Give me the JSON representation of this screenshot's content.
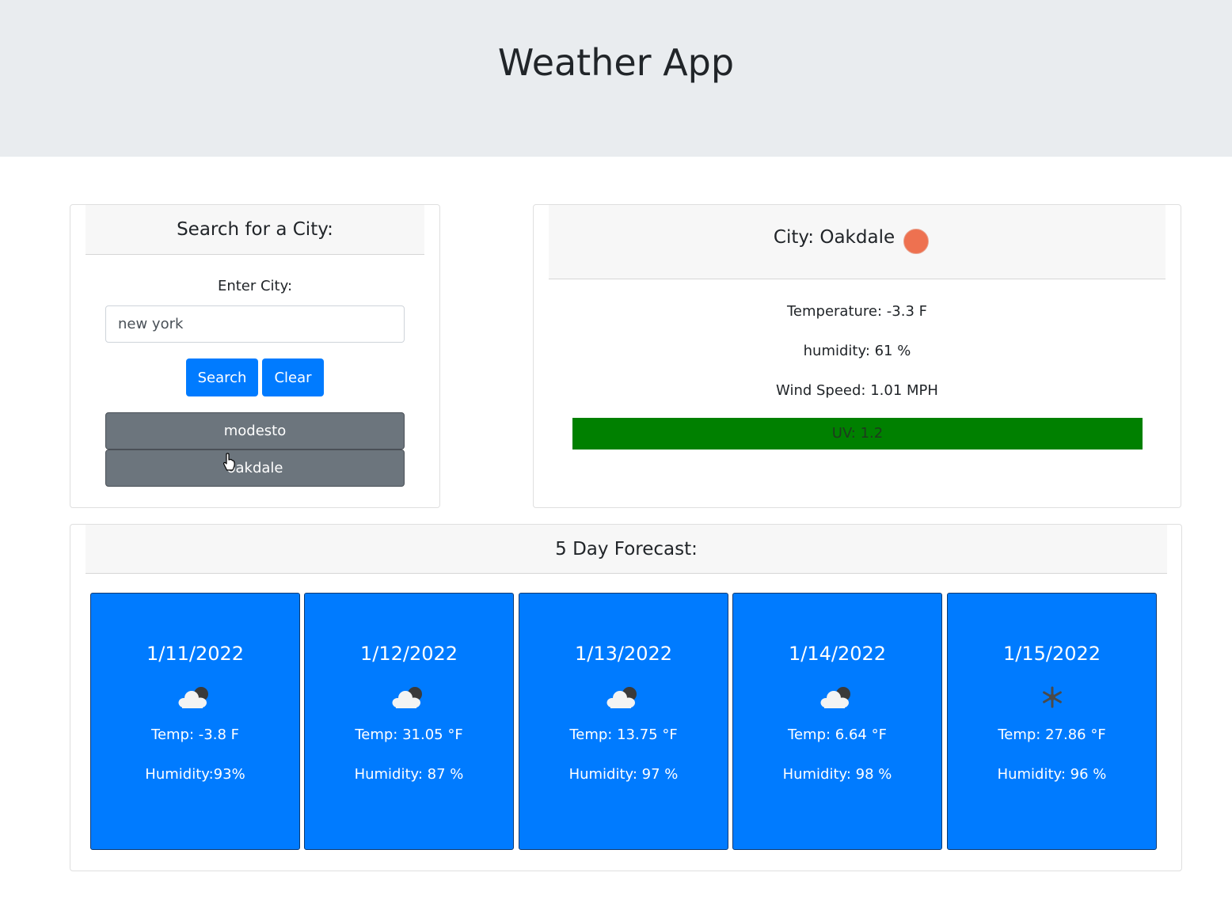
{
  "header": {
    "title": "Weather App"
  },
  "search": {
    "title": "Search for a City:",
    "label": "Enter City:",
    "input_value": "new york",
    "search_label": "Search",
    "clear_label": "Clear",
    "history": [
      "modesto",
      "oakdale"
    ]
  },
  "current": {
    "city": "City: Oakdale",
    "icon": "sun-icon",
    "temperature": "Temperature: -3.3 F",
    "humidity": "humidity: 61 %",
    "wind": "Wind Speed: 1.01 MPH",
    "uv": "UV: 1.2",
    "uv_color": "#008000"
  },
  "forecast": {
    "title": "5 Day Forecast:",
    "days": [
      {
        "date": "1/11/2022",
        "icon": "cloud-night-icon",
        "temp": "Temp: -3.8 F",
        "humidity": "Humidity:93%"
      },
      {
        "date": "1/12/2022",
        "icon": "cloud-night-icon",
        "temp": "Temp: 31.05 °F",
        "humidity": "Humidity: 87 %"
      },
      {
        "date": "1/13/2022",
        "icon": "cloud-night-icon",
        "temp": "Temp: 13.75 °F",
        "humidity": "Humidity: 97 %"
      },
      {
        "date": "1/14/2022",
        "icon": "cloud-night-icon",
        "temp": "Temp: 6.64 °F",
        "humidity": "Humidity: 98 %"
      },
      {
        "date": "1/15/2022",
        "icon": "snowflake-icon",
        "temp": "Temp: 27.86 °F",
        "humidity": "Humidity: 96 %"
      }
    ]
  },
  "colors": {
    "primary": "#007bff",
    "secondary": "#6c757d",
    "jumbotron": "#e9ecef",
    "sun": "#ee7150"
  }
}
